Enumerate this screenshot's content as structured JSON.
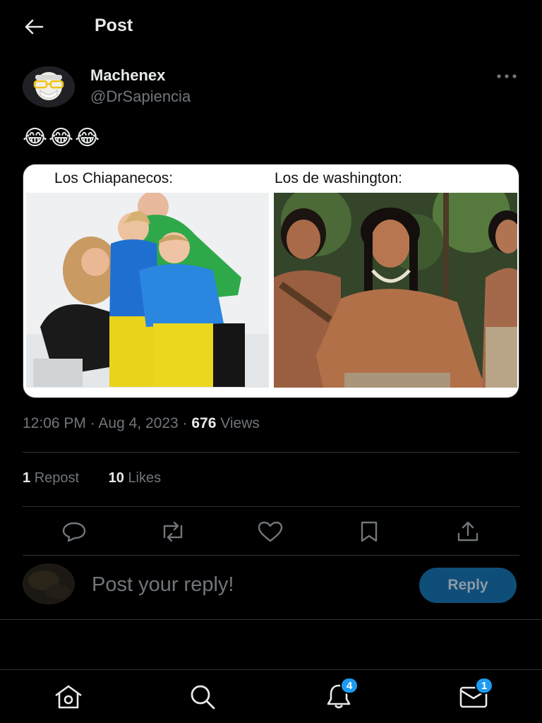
{
  "header": {
    "title": "Post"
  },
  "author": {
    "display_name": "Machenex",
    "handle": "@DrSapiencia"
  },
  "post": {
    "text": "😂😂😂",
    "media": {
      "caption_left": "Los Chiapanecos:",
      "caption_right": "Los de washington:"
    },
    "time": "12:06 PM",
    "date": "Aug 4, 2023",
    "views_count": "676",
    "views_label": "Views"
  },
  "stats": {
    "reposts_count": "1",
    "reposts_label": "Repost",
    "likes_count": "10",
    "likes_label": "Likes"
  },
  "reply": {
    "placeholder": "Post your reply!",
    "button_label": "Reply"
  },
  "nav": {
    "notifications_badge": "4",
    "messages_badge": "1"
  },
  "colors": {
    "background": "#000000",
    "text": "#e7e9ea",
    "muted": "#71767b",
    "accent": "#1d9bf0",
    "reply_button": "#0f4e78",
    "divider": "#2f3336"
  },
  "icons": [
    "back-arrow-icon",
    "more-icon",
    "reply-icon",
    "repost-icon",
    "like-icon",
    "bookmark-icon",
    "share-icon",
    "home-icon",
    "search-icon",
    "bell-icon",
    "mail-icon"
  ]
}
